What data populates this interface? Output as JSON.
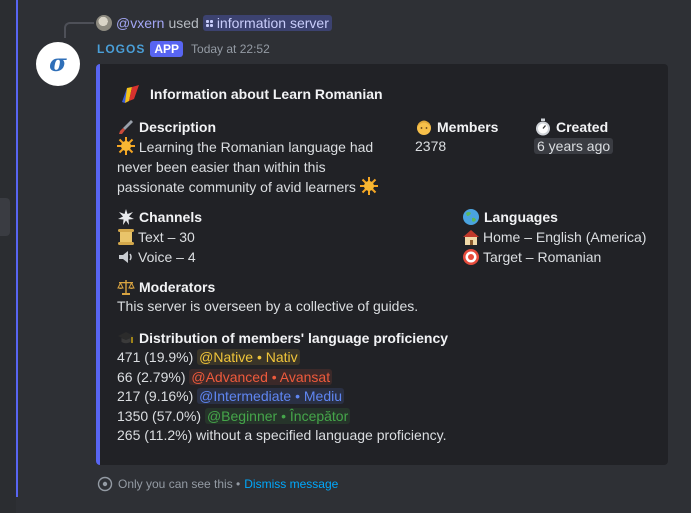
{
  "colors": {
    "accent": "#5865f2",
    "background": "#2b2d31",
    "embed_bg": "#212226",
    "native_role": "#f0c53a",
    "advanced_role": "#ef5a3c",
    "intermediate_role": "#5f86f2",
    "beginner_role": "#45a64a"
  },
  "interaction": {
    "user": "@vxern",
    "used_text": "used",
    "command": "information server"
  },
  "message": {
    "author": "LOGOS",
    "app_tag": "APP",
    "timestamp": "Today at 22:52",
    "avatar_glyph": "σ"
  },
  "embed": {
    "title": "Information about Learn Romanian",
    "description": {
      "name": "Description",
      "value": "Learning the Romanian language had never been easier than within this passionate community of avid learners"
    },
    "members": {
      "name": "Members",
      "value": "2378"
    },
    "created": {
      "name": "Created",
      "value": "6 years ago"
    },
    "channels": {
      "name": "Channels",
      "text": "Text – 30",
      "voice": "Voice – 4"
    },
    "languages": {
      "name": "Languages",
      "home": "Home – English (America)",
      "target": "Target – Romanian"
    },
    "moderators": {
      "name": "Moderators",
      "value": "This server is overseen by a collective of guides."
    },
    "distribution": {
      "name": "Distribution of members' language proficiency",
      "rows": [
        {
          "count": "471 (19.9%)",
          "role": "@Native • Nativ"
        },
        {
          "count": "66 (2.79%)",
          "role": "@Advanced • Avansat"
        },
        {
          "count": "217 (9.16%)",
          "role": "@Intermediate • Mediu"
        },
        {
          "count": "1350 (57.0%)",
          "role": "@Beginner • Începător"
        }
      ],
      "unspecified": "265 (11.2%) without a specified language proficiency."
    }
  },
  "footer": {
    "only_you": "Only you can see this •",
    "dismiss": "Dismiss message"
  },
  "icons": {
    "title": "romanian-flag-icon",
    "description": "brush-icon",
    "sun": "sun-icon",
    "members": "person-icon",
    "created": "stopwatch-icon",
    "channels": "sparkle-icon",
    "text_channel": "scroll-icon",
    "voice_channel": "speaker-icon",
    "languages": "globe-icon",
    "home": "house-icon",
    "target": "target-icon",
    "moderators": "scales-icon",
    "distribution": "graduation-cap-icon",
    "ephemeral": "eye-icon"
  }
}
